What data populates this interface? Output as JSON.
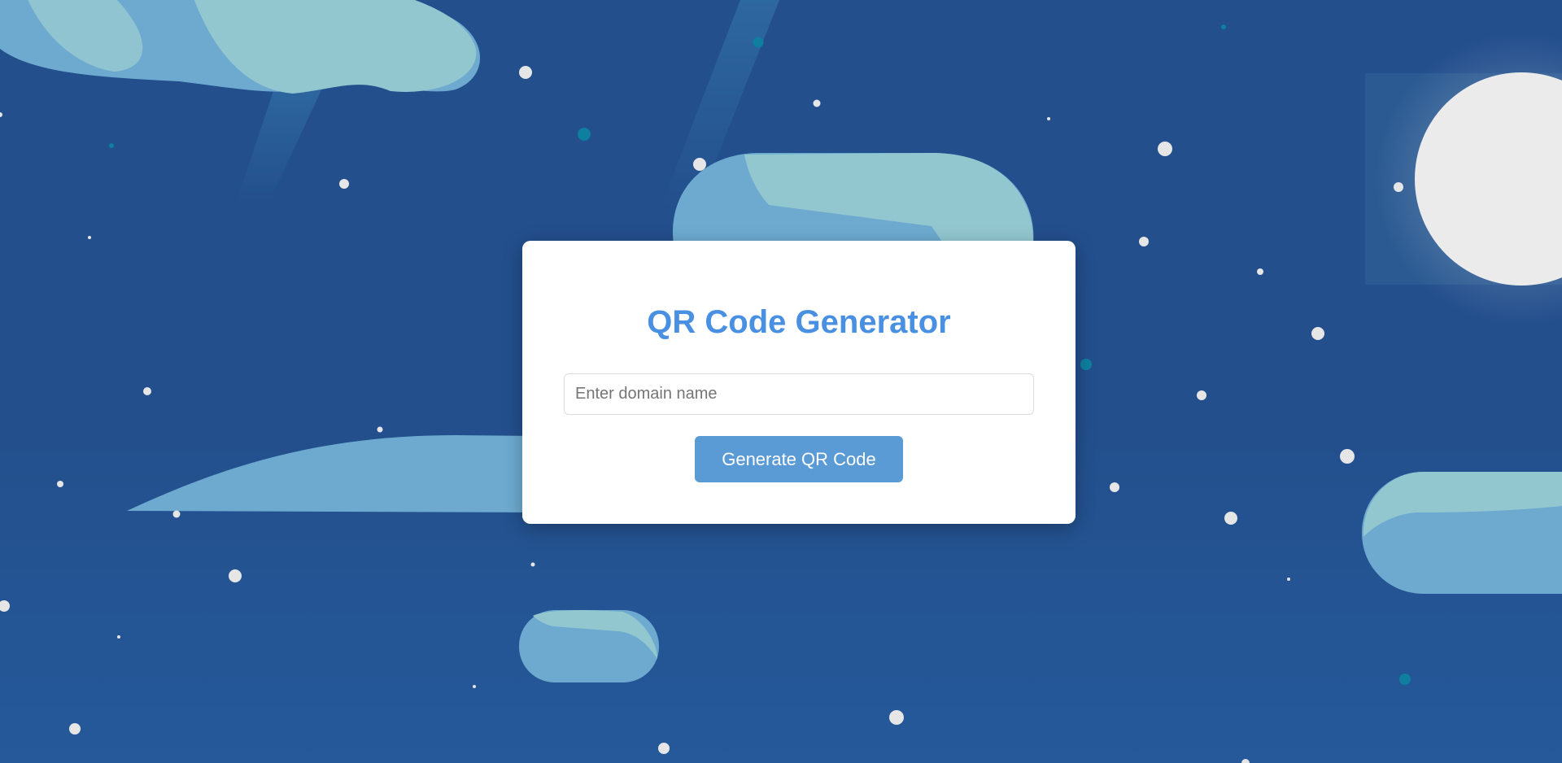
{
  "app": {
    "title": "QR Code Generator"
  },
  "form": {
    "domain_input": {
      "value": "",
      "placeholder": "Enter domain name"
    },
    "generate_button_label": "Generate QR Code"
  },
  "theme": {
    "accent": "#4a90e2",
    "button": "#5b9bd5",
    "sky": "#234f8d",
    "cloud_light": "#93c7d0",
    "cloud_mid": "#6eaad0",
    "moon": "#ebebeb"
  },
  "decorations": {
    "icons": [
      "moon-icon",
      "cloud-icon",
      "star-icon"
    ]
  }
}
